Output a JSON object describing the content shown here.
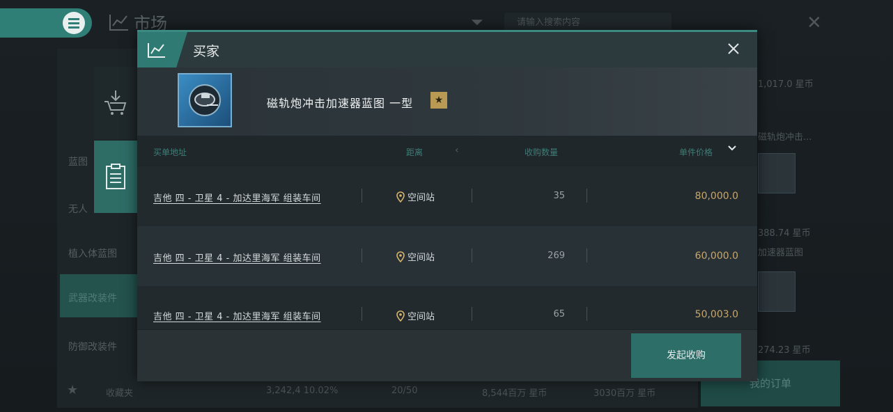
{
  "background": {
    "title": "市场",
    "search_placeholder": "请输入搜索内容",
    "left_menu": [
      "蓝图",
      "无人",
      "植入体蓝图",
      "武器改装件",
      "防御改装件"
    ],
    "bottom_bar": {
      "favorites_label": "收藏夹",
      "stats": [
        "3,242,4 10.02%",
        "20/50",
        "8,544百万 星币",
        "3030百万 星币"
      ]
    },
    "orders_button": "我的订单",
    "right_list": [
      "1,017.0 星币",
      "磁轨炮冲击...",
      "388.74 星币",
      "加速器蓝图",
      "274.23 星币"
    ]
  },
  "dialog": {
    "title": "买家",
    "item": {
      "name": "磁轨炮冲击加速器蓝图 一型"
    },
    "columns": {
      "location": "买单地址",
      "distance": "距离",
      "quantity": "收购数量",
      "unit_price": "单件价格"
    },
    "rows": [
      {
        "location": "吉他 四 - 卫星 4 - 加达里海军 组装车间",
        "distance": "空间站",
        "quantity": "35",
        "price": "80,000.0"
      },
      {
        "location": "吉他 四 - 卫星 4 - 加达里海军 组装车间",
        "distance": "空间站",
        "quantity": "269",
        "price": "60,000.0"
      },
      {
        "location": "吉他 四 - 卫星 4 - 加达里海军 组装车间",
        "distance": "空间站",
        "quantity": "65",
        "price": "50,003.0"
      }
    ],
    "buy_button": "发起收购"
  },
  "colors": {
    "accent": "#2f7a72",
    "price": "#c8a76a",
    "star": "#b89a55"
  }
}
